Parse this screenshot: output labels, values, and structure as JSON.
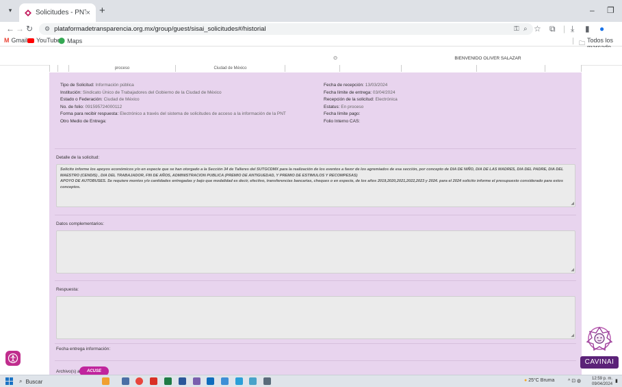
{
  "browser": {
    "tab_title": "Solicitudes - PNT",
    "tab_close": "×",
    "new_tab": "+",
    "url": "plataformadetransparencia.org.mx/group/guest/sisai_solicitudes#/historial",
    "bookmarks": [
      {
        "label": "Gmail",
        "icon": "gmail-icon",
        "color": "#ea4335"
      },
      {
        "label": "YouTube",
        "icon": "youtube-icon",
        "color": "#ff0000"
      },
      {
        "label": "Maps",
        "icon": "maps-icon",
        "color": "#34a853"
      }
    ],
    "all_bookmarks": "Todos los marcado"
  },
  "page": {
    "welcome": "BIENVENIDO OLIVER SALAZAR",
    "previous_row": [
      "proceso",
      "Ciudad de México"
    ],
    "info_left": [
      {
        "label": "Tipo de Solicitud:",
        "value": "Información pública"
      },
      {
        "label": "Institución:",
        "value": "Sindicato Único de Trabajadores del Gobierno de la Ciudad de México"
      },
      {
        "label": "Estado o Federación:",
        "value": "Ciudad de México"
      },
      {
        "label": "No. de folio:",
        "value": "091595724000112"
      },
      {
        "label": "Forma para recibir respuesta:",
        "value": "Electrónico a través del sistema de solicitudes de acceso a la información de la PNT"
      },
      {
        "label": "Otro Medio de Entrega:",
        "value": ""
      }
    ],
    "info_right": [
      {
        "label": "Fecha de recepción:",
        "value": "13/03/2024"
      },
      {
        "label": "Fecha límite de entrega:",
        "value": "03/04/2024"
      },
      {
        "label": "Recepción de la solicitud:",
        "value": "Electrónica"
      },
      {
        "label": "Estatus:",
        "value": "En proceso"
      },
      {
        "label": "Fecha límite pago:",
        "value": ""
      },
      {
        "label": "Folio Interno CAS:",
        "value": ""
      }
    ],
    "detail_label": "Detalle de la solicitud:",
    "detail_text": "Solicito informe los apoyos económicos y/o en especie que se han otorgado a la Sección 34 de Talleres del SUTGCDMX para la realización  de los eventos a favor de los agremiados  de esa sección, por concepto de DIA DE NIÑO, DIA DE LAS MADRES, DIA DEL PADRE, DIA DEL MAESTRO (CENDIS) , DIA DEL TRABAJADOR, FIN DE AÑOS, ADMINISTRACION PUBLICA (PREMIO DE ANTIGUEDAD, Y PREMIO DE ESTIMULOS Y RECOMPESAS)\nAPOYO DE AUTOBUSES.  Se requiere montos y/o cantidades entregadas y bajo que modalidad es decir, efectivo, transferencias bancarias, cheques o en especie, de los años 2019,2020,2021,2022,2023 y 2024. para el 2024 solicito informe el presupuesto considerado para estos conceptos.",
    "complementary_label": "Datos complementarios:",
    "response_label": "Respuesta:",
    "delivery_date_label": "Fecha entrega información:",
    "attachments_label": "Archivo(s) adjunto(s):",
    "acuse_button": "ACUSE",
    "assistant_label": "CAVINAI"
  },
  "taskbar": {
    "search": "Buscar",
    "weather": "25°C  Bruma",
    "time": "12:59 p. m.",
    "date": "09/04/2024"
  },
  "colors": {
    "panel": "#e8d4ee",
    "accent": "#c0259d",
    "assistant": "#5b2278"
  }
}
